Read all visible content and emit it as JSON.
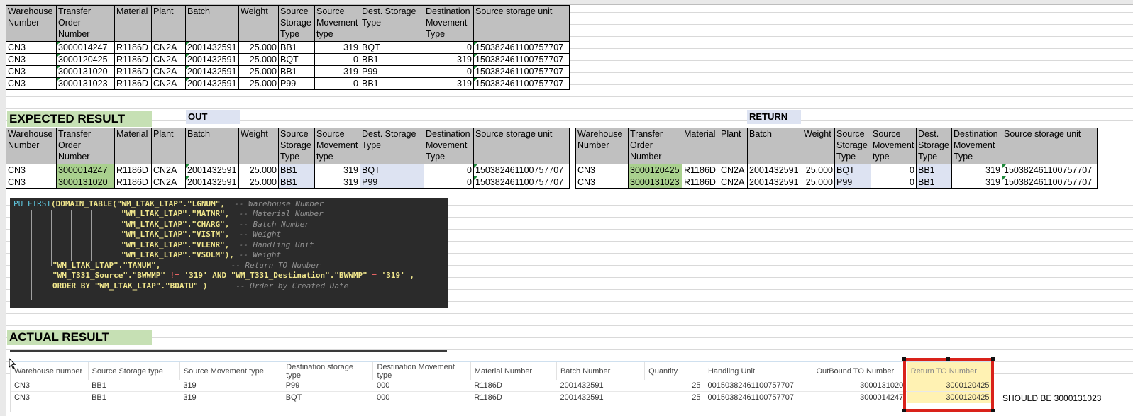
{
  "headers": [
    "Warehouse Number",
    "Transfer Order Number",
    "Material",
    "Plant",
    "Batch",
    "Weight",
    "Source Storage Type",
    "Source Movement type",
    "Dest. Storage Type",
    "Destination Movement Type",
    "Source storage unit"
  ],
  "top_table": [
    [
      "CN3",
      "3000014247",
      "R1186D",
      "CN2A",
      "2001432591",
      "25.000",
      "BB1",
      "319",
      "BQT",
      "0",
      "150382461100757707"
    ],
    [
      "CN3",
      "3000120425",
      "R1186D",
      "CN2A",
      "2001432591",
      "25.000",
      "BQT",
      "0",
      "BB1",
      "319",
      "150382461100757707"
    ],
    [
      "CN3",
      "3000131020",
      "R1186D",
      "CN2A",
      "2001432591",
      "25.000",
      "BB1",
      "319",
      "P99",
      "0",
      "150382461100757707"
    ],
    [
      "CN3",
      "3000131023",
      "R1186D",
      "CN2A",
      "2001432591",
      "25.000",
      "P99",
      "0",
      "BB1",
      "319",
      "150382461100757707"
    ]
  ],
  "expected": {
    "title": "EXPECTED RESULT",
    "out_label": "OUT",
    "return_label": "RETURN",
    "out_rows": [
      [
        "CN3",
        "3000014247",
        "R1186D",
        "CN2A",
        "2001432591",
        "25.000",
        "BB1",
        "319",
        "BQT",
        "0",
        "150382461100757707"
      ],
      [
        "CN3",
        "3000131020",
        "R1186D",
        "CN2A",
        "2001432591",
        "25.000",
        "BB1",
        "319",
        "P99",
        "0",
        "150382461100757707"
      ]
    ],
    "return_rows": [
      [
        "CN3",
        "3000120425",
        "R1186D",
        "CN2A",
        "2001432591",
        "25.000",
        "BQT",
        "0",
        "BB1",
        "319",
        "150382461100757707"
      ],
      [
        "CN3",
        "3000131023",
        "R1186D",
        "CN2A",
        "2001432591",
        "25.000",
        "P99",
        "0",
        "BB1",
        "319",
        "150382461100757707"
      ]
    ]
  },
  "code": {
    "fn": "PU_FIRST",
    "fn2": "DOMAIN_TABLE",
    "l1": "\"WM_LTAK_LTAP\".\"LGNUM\",",
    "c1": "-- Warehouse Number",
    "l2": "\"WM_LTAK_LTAP\".\"MATNR\",",
    "c2": "-- Material Number",
    "l3": "\"WM_LTAK_LTAP\".\"CHARG\",",
    "c3": "-- Batch Number",
    "l4": "\"WM_LTAK_LTAP\".\"VISTM\",",
    "c4": "-- Weight",
    "l5": "\"WM_LTAK_LTAP\".\"VLENR\",",
    "c5": "-- Handling Unit",
    "l6": "\"WM_LTAK_LTAP\".\"VSOLM\"),",
    "c6": "-- Weight",
    "l7": "\"WM_LTAK_LTAP\".\"TANUM\",",
    "c7": "-- Return TO Number",
    "l8a": "\"WM_T331_Source\".\"BWWMP\"",
    "l8op": "!=",
    "l8b": "'319'",
    "l8and": "AND",
    "l8c": "\"WM_T331_Destination\".\"BWWMP\"",
    "l8eq": "=",
    "l8d": "'319' ,",
    "l9kw": "ORDER BY",
    "l9a": "\"WM_LTAK_LTAP\".\"BDATU\" )",
    "c9": "-- Order by Created Date"
  },
  "actual": {
    "title": "ACTUAL RESULT",
    "headers": [
      "Warehouse number",
      "Source Storage type",
      "Source Movement type",
      "Destination storage type",
      "Destination Movement type",
      "Material Number",
      "Batch Number",
      "Quantity",
      "Handling Unit",
      "OutBound TO Number",
      "Return TO Number"
    ],
    "rows": [
      [
        "CN3",
        "BB1",
        "319",
        "P99",
        "000",
        "R1186D",
        "2001432591",
        "25",
        "00150382461100757707",
        "3000131020",
        "3000120425"
      ],
      [
        "CN3",
        "BB1",
        "319",
        "BQT",
        "000",
        "R1186D",
        "2001432591",
        "25",
        "00150382461100757707",
        "3000014247",
        "3000120425"
      ]
    ],
    "note": "SHOULD BE 3000131023"
  }
}
